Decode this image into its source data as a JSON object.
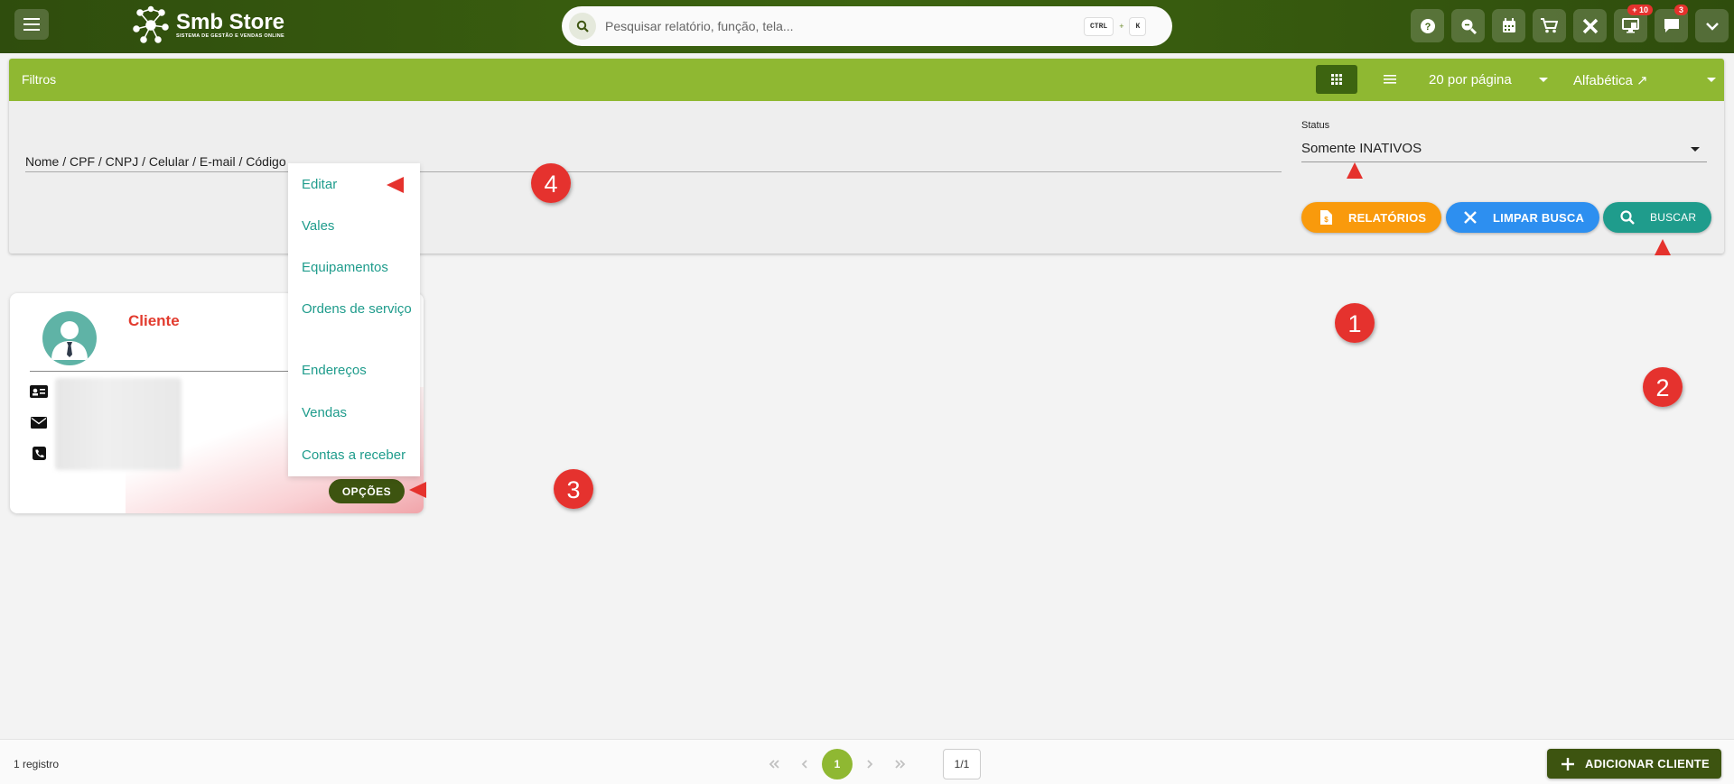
{
  "app": {
    "logo_title": "Smb Store",
    "logo_subtitle": "SISTEMA DE GESTÃO E VENDAS ONLINE"
  },
  "search": {
    "placeholder": "Pesquisar relatório, função, tela...",
    "shortcut_key1": "CTRL",
    "shortcut_plus": "+",
    "shortcut_key2": "K"
  },
  "top_icons": [
    {
      "name": "help-icon"
    },
    {
      "name": "zoom-search-icon"
    },
    {
      "name": "calendar-icon"
    },
    {
      "name": "cart-icon"
    },
    {
      "name": "tools-icon"
    },
    {
      "name": "monitor-icon",
      "badge": "+ 10"
    },
    {
      "name": "chat-icon",
      "badge": "3"
    },
    {
      "name": "chevron-down-icon"
    }
  ],
  "filters": {
    "title": "Filtros",
    "per_page": "20 por página",
    "sort": "Alfabética ↗",
    "search_placeholder": "Nome / CPF / CNPJ / Celular / E-mail / Código",
    "status_label": "Status",
    "status_value": "Somente INATIVOS"
  },
  "buttons": {
    "reports": "RELATÓRIOS",
    "clear": "LIMPAR BUSCA",
    "search": "BUSCAR",
    "options": "OPÇÕES",
    "add_client": "ADICIONAR CLIENTE"
  },
  "card": {
    "name": "Cliente"
  },
  "menu": {
    "items": [
      "Editar",
      "Vales",
      "Equipamentos",
      "Ordens de serviço",
      "Endereços",
      "Vendas",
      "Contas a receber"
    ]
  },
  "annotations": [
    "1",
    "2",
    "3",
    "4"
  ],
  "footer": {
    "records": "1 registro",
    "current_page": "1",
    "page_of": "1/1"
  },
  "colors": {
    "topbar": "#3d6410",
    "filter_header": "#8fb832",
    "accent_teal": "#1f9c8c",
    "reports_orange": "#f99a0c",
    "clear_blue": "#2d8ff0",
    "annotation_red": "#e5322d",
    "client_name": "#e23b2e"
  }
}
